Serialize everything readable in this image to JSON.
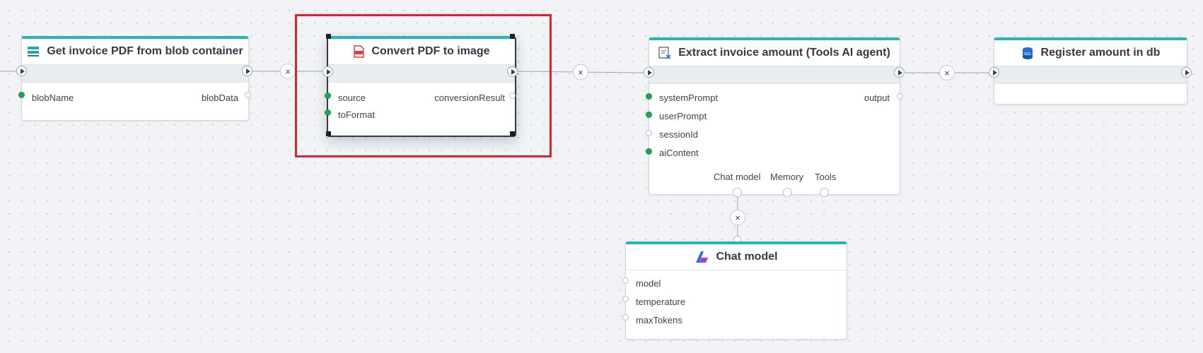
{
  "nodes": {
    "get_invoice": {
      "title": "Get invoice PDF from blob container",
      "icon": "blob-storage-icon",
      "inputs": [
        "blobName"
      ],
      "outputs": [
        "blobData"
      ]
    },
    "convert_pdf": {
      "title": "Convert PDF to image",
      "icon": "pdf-icon",
      "inputs": [
        "source",
        "toFormat"
      ],
      "outputs": [
        "conversionResult"
      ]
    },
    "extract_invoice": {
      "title": "Extract invoice amount (Tools AI agent)",
      "icon": "ai-agent-icon",
      "inputs": [
        "systemPrompt",
        "userPrompt",
        "sessionId",
        "aiContent"
      ],
      "outputs": [
        "output"
      ],
      "sub_ports": [
        "Chat model",
        "Memory",
        "Tools"
      ]
    },
    "register_amount": {
      "title": "Register amount in db",
      "icon": "sql-database-icon"
    },
    "chat_model": {
      "title": "Chat model",
      "icon": "azure-openai-icon",
      "inputs": [
        "model",
        "temperature",
        "maxTokens"
      ]
    }
  },
  "edge_remove_symbol": "×",
  "colors": {
    "accent": "#25b6b6",
    "connected_pin": "#1ea55a",
    "selection": "#e0202a"
  }
}
